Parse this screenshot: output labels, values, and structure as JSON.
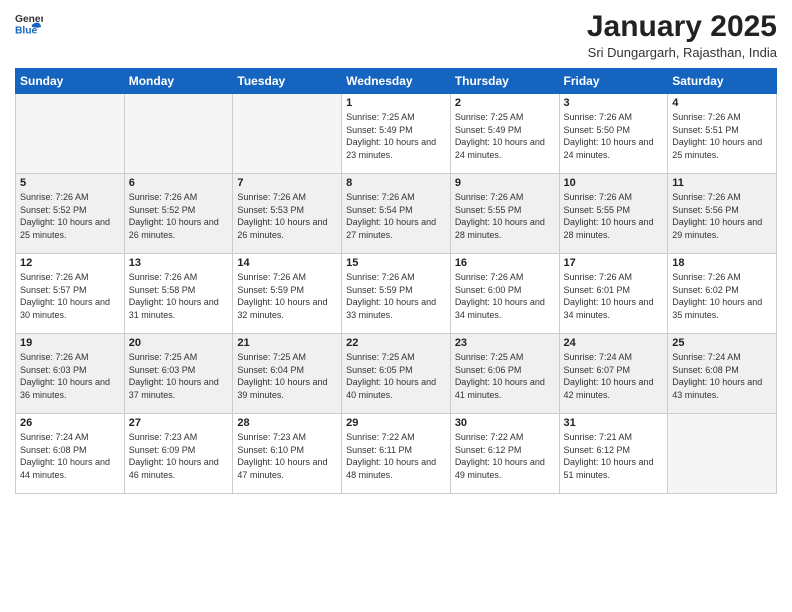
{
  "header": {
    "logo_general": "General",
    "logo_blue": "Blue",
    "month_title": "January 2025",
    "subtitle": "Sri Dungargarh, Rajasthan, India"
  },
  "days_of_week": [
    "Sunday",
    "Monday",
    "Tuesday",
    "Wednesday",
    "Thursday",
    "Friday",
    "Saturday"
  ],
  "weeks": [
    [
      {
        "day": "",
        "empty": true
      },
      {
        "day": "",
        "empty": true
      },
      {
        "day": "",
        "empty": true
      },
      {
        "day": "1",
        "sunrise": "Sunrise: 7:25 AM",
        "sunset": "Sunset: 5:49 PM",
        "daylight": "Daylight: 10 hours and 23 minutes."
      },
      {
        "day": "2",
        "sunrise": "Sunrise: 7:25 AM",
        "sunset": "Sunset: 5:49 PM",
        "daylight": "Daylight: 10 hours and 24 minutes."
      },
      {
        "day": "3",
        "sunrise": "Sunrise: 7:26 AM",
        "sunset": "Sunset: 5:50 PM",
        "daylight": "Daylight: 10 hours and 24 minutes."
      },
      {
        "day": "4",
        "sunrise": "Sunrise: 7:26 AM",
        "sunset": "Sunset: 5:51 PM",
        "daylight": "Daylight: 10 hours and 25 minutes."
      }
    ],
    [
      {
        "day": "5",
        "sunrise": "Sunrise: 7:26 AM",
        "sunset": "Sunset: 5:52 PM",
        "daylight": "Daylight: 10 hours and 25 minutes."
      },
      {
        "day": "6",
        "sunrise": "Sunrise: 7:26 AM",
        "sunset": "Sunset: 5:52 PM",
        "daylight": "Daylight: 10 hours and 26 minutes."
      },
      {
        "day": "7",
        "sunrise": "Sunrise: 7:26 AM",
        "sunset": "Sunset: 5:53 PM",
        "daylight": "Daylight: 10 hours and 26 minutes."
      },
      {
        "day": "8",
        "sunrise": "Sunrise: 7:26 AM",
        "sunset": "Sunset: 5:54 PM",
        "daylight": "Daylight: 10 hours and 27 minutes."
      },
      {
        "day": "9",
        "sunrise": "Sunrise: 7:26 AM",
        "sunset": "Sunset: 5:55 PM",
        "daylight": "Daylight: 10 hours and 28 minutes."
      },
      {
        "day": "10",
        "sunrise": "Sunrise: 7:26 AM",
        "sunset": "Sunset: 5:55 PM",
        "daylight": "Daylight: 10 hours and 28 minutes."
      },
      {
        "day": "11",
        "sunrise": "Sunrise: 7:26 AM",
        "sunset": "Sunset: 5:56 PM",
        "daylight": "Daylight: 10 hours and 29 minutes."
      }
    ],
    [
      {
        "day": "12",
        "sunrise": "Sunrise: 7:26 AM",
        "sunset": "Sunset: 5:57 PM",
        "daylight": "Daylight: 10 hours and 30 minutes."
      },
      {
        "day": "13",
        "sunrise": "Sunrise: 7:26 AM",
        "sunset": "Sunset: 5:58 PM",
        "daylight": "Daylight: 10 hours and 31 minutes."
      },
      {
        "day": "14",
        "sunrise": "Sunrise: 7:26 AM",
        "sunset": "Sunset: 5:59 PM",
        "daylight": "Daylight: 10 hours and 32 minutes."
      },
      {
        "day": "15",
        "sunrise": "Sunrise: 7:26 AM",
        "sunset": "Sunset: 5:59 PM",
        "daylight": "Daylight: 10 hours and 33 minutes."
      },
      {
        "day": "16",
        "sunrise": "Sunrise: 7:26 AM",
        "sunset": "Sunset: 6:00 PM",
        "daylight": "Daylight: 10 hours and 34 minutes."
      },
      {
        "day": "17",
        "sunrise": "Sunrise: 7:26 AM",
        "sunset": "Sunset: 6:01 PM",
        "daylight": "Daylight: 10 hours and 34 minutes."
      },
      {
        "day": "18",
        "sunrise": "Sunrise: 7:26 AM",
        "sunset": "Sunset: 6:02 PM",
        "daylight": "Daylight: 10 hours and 35 minutes."
      }
    ],
    [
      {
        "day": "19",
        "sunrise": "Sunrise: 7:26 AM",
        "sunset": "Sunset: 6:03 PM",
        "daylight": "Daylight: 10 hours and 36 minutes."
      },
      {
        "day": "20",
        "sunrise": "Sunrise: 7:25 AM",
        "sunset": "Sunset: 6:03 PM",
        "daylight": "Daylight: 10 hours and 37 minutes."
      },
      {
        "day": "21",
        "sunrise": "Sunrise: 7:25 AM",
        "sunset": "Sunset: 6:04 PM",
        "daylight": "Daylight: 10 hours and 39 minutes."
      },
      {
        "day": "22",
        "sunrise": "Sunrise: 7:25 AM",
        "sunset": "Sunset: 6:05 PM",
        "daylight": "Daylight: 10 hours and 40 minutes."
      },
      {
        "day": "23",
        "sunrise": "Sunrise: 7:25 AM",
        "sunset": "Sunset: 6:06 PM",
        "daylight": "Daylight: 10 hours and 41 minutes."
      },
      {
        "day": "24",
        "sunrise": "Sunrise: 7:24 AM",
        "sunset": "Sunset: 6:07 PM",
        "daylight": "Daylight: 10 hours and 42 minutes."
      },
      {
        "day": "25",
        "sunrise": "Sunrise: 7:24 AM",
        "sunset": "Sunset: 6:08 PM",
        "daylight": "Daylight: 10 hours and 43 minutes."
      }
    ],
    [
      {
        "day": "26",
        "sunrise": "Sunrise: 7:24 AM",
        "sunset": "Sunset: 6:08 PM",
        "daylight": "Daylight: 10 hours and 44 minutes."
      },
      {
        "day": "27",
        "sunrise": "Sunrise: 7:23 AM",
        "sunset": "Sunset: 6:09 PM",
        "daylight": "Daylight: 10 hours and 46 minutes."
      },
      {
        "day": "28",
        "sunrise": "Sunrise: 7:23 AM",
        "sunset": "Sunset: 6:10 PM",
        "daylight": "Daylight: 10 hours and 47 minutes."
      },
      {
        "day": "29",
        "sunrise": "Sunrise: 7:22 AM",
        "sunset": "Sunset: 6:11 PM",
        "daylight": "Daylight: 10 hours and 48 minutes."
      },
      {
        "day": "30",
        "sunrise": "Sunrise: 7:22 AM",
        "sunset": "Sunset: 6:12 PM",
        "daylight": "Daylight: 10 hours and 49 minutes."
      },
      {
        "day": "31",
        "sunrise": "Sunrise: 7:21 AM",
        "sunset": "Sunset: 6:12 PM",
        "daylight": "Daylight: 10 hours and 51 minutes."
      },
      {
        "day": "",
        "empty": true
      }
    ]
  ]
}
